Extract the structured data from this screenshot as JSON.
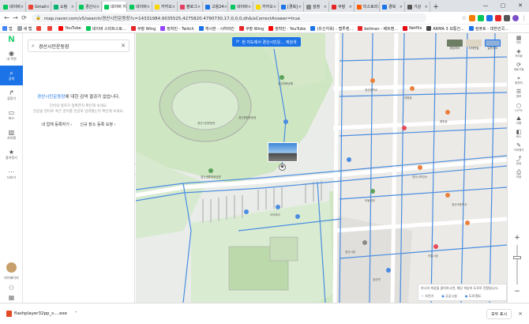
{
  "browser": {
    "tabs": [
      {
        "title": "네이버",
        "color": "#03c75a"
      },
      {
        "title": "Gmail",
        "color": "#ea4335"
      },
      {
        "title": "쇼핑",
        "color": "#00b46e"
      },
      {
        "title": "경산시",
        "color": "#03c75a"
      },
      {
        "title": "네이버 지도",
        "color": "#03c75a",
        "active": true
      },
      {
        "title": "네이버",
        "color": "#03c75a"
      },
      {
        "title": "카카오",
        "color": "#f7d600"
      },
      {
        "title": "블로그",
        "color": "#e4405f"
      },
      {
        "title": "고용24",
        "color": "#1c73e8"
      },
      {
        "title": "네이버",
        "color": "#03c75a"
      },
      {
        "title": "카카오",
        "color": "#f7d600"
      },
      {
        "title": "[경북]",
        "color": "#1c73e8"
      },
      {
        "title": "설정",
        "color": "#888888"
      },
      {
        "title": "쿠팡",
        "color": "#e52528"
      },
      {
        "title": "티스토리",
        "color": "#ff5a00"
      },
      {
        "title": "경북",
        "color": "#1c73e8"
      },
      {
        "title": "기상",
        "color": "#555555"
      }
    ],
    "url": "map.naver.com/v5/search/경산시민운동장?c=14331984.9035525,4275820.4790730,17,0,0,0,dh&isCorrectAnswer=true",
    "bookmarks": [
      {
        "label": "앱",
        "color": "#4285f4"
      },
      {
        "label": "새 탭",
        "color": "#9aa0a6"
      },
      {
        "label": "",
        "color": "#ea4335"
      },
      {
        "label": "",
        "color": "#ea4335"
      },
      {
        "label": "YouTube",
        "color": "#ff0000"
      },
      {
        "label": "네이버 스마트스토...",
        "color": "#03c75a"
      },
      {
        "label": "쿠팡 Wing",
        "color": "#e52528"
      },
      {
        "label": "정착민 - Twitch",
        "color": "#9146ff"
      },
      {
        "label": "게시판 - 시하비킨",
        "color": "#1c73e8"
      },
      {
        "label": "쿠팡 Wing",
        "color": "#e52528"
      },
      {
        "label": "정착민 - YouTube",
        "color": "#ff0000"
      },
      {
        "label": "(유신지워) - 맵투켄...",
        "color": "#1c73e8"
      },
      {
        "label": "betman - 베트맨...",
        "color": "#e52528"
      },
      {
        "label": "Netflix",
        "color": "#e50914"
      },
      {
        "label": "ARMA 3 보통간...",
        "color": "#444444"
      },
      {
        "label": "컴퓨토 - 대한민국...",
        "color": "#1c73e8"
      }
    ]
  },
  "sidebar": {
    "logo": "N",
    "items": [
      {
        "icon": "◉",
        "label": "내 주변"
      },
      {
        "icon": "⌕",
        "label": "검색",
        "active": true
      },
      {
        "icon": "↱",
        "label": "길찾기"
      },
      {
        "icon": "▭",
        "label": "버스"
      },
      {
        "icon": "▥",
        "label": "지하철"
      },
      {
        "icon": "★",
        "label": "즐겨찾기"
      },
      {
        "icon": "⋯",
        "label": "더보기"
      }
    ],
    "profile_label": "마이페이지"
  },
  "search": {
    "value": "경산시민운동장",
    "no_result_keyword": "경산시민운동장",
    "no_result_text": "에 대한 검색 결과가 없습니다.",
    "hint1": "단어의 철자가 정확한지 확인해 보세요.",
    "hint2": "한글을 영어로 혹은 영어를 한글로 입력했는지 확인해 보세요.",
    "link1": "내 업체 등록하기 ›",
    "link2": "신규 장소 등록 요청 ›"
  },
  "map": {
    "search_here": "현 지도에서 경산시민운... 재검색",
    "layers": [
      {
        "label": "위성지도",
        "color": "#6d7e63"
      },
      {
        "label": "지적편집",
        "color": "#ddd6c4"
      },
      {
        "label": "일반지도",
        "color": "#8fb0d9"
      }
    ],
    "labels": [
      "경산시민운동장",
      "경산체육공원",
      "경산생활체육공원",
      "경산종합운동장",
      "아이파크",
      "아동센터",
      "경산시청",
      "대평동",
      "중방동",
      "경산시보건소",
      "경산중학교",
      "경산초등학교",
      "경산역",
      "전통시장"
    ],
    "legend_title": "하나의 색상을 클릭하시면, 해당 색상의 도로로 전환됩니다.",
    "legend_items": [
      "자전거",
      "공공시설",
      "도로/철도"
    ]
  },
  "rightbar": {
    "items": [
      {
        "icon": "▦",
        "label": "지도"
      },
      {
        "icon": "◈",
        "label": "거리뷰"
      },
      {
        "icon": "⟳",
        "label": "새로고침"
      },
      {
        "icon": "⌖",
        "label": "현위치"
      },
      {
        "icon": "☰",
        "label": "정보"
      },
      {
        "icon": "⬡",
        "label": "CCTV"
      },
      {
        "icon": "⛰",
        "label": "지형"
      },
      {
        "icon": "◧",
        "label": "버스"
      },
      {
        "icon": "✎",
        "label": "거리재기"
      },
      {
        "icon": "⤴",
        "label": "공유"
      },
      {
        "icon": "⎙",
        "label": "저장"
      }
    ],
    "zoom_in": "+",
    "zoom_out": "−"
  },
  "download": {
    "filename": "flashplayer32pp_s....exe",
    "show_all": "모두 표시",
    "close": "×"
  }
}
